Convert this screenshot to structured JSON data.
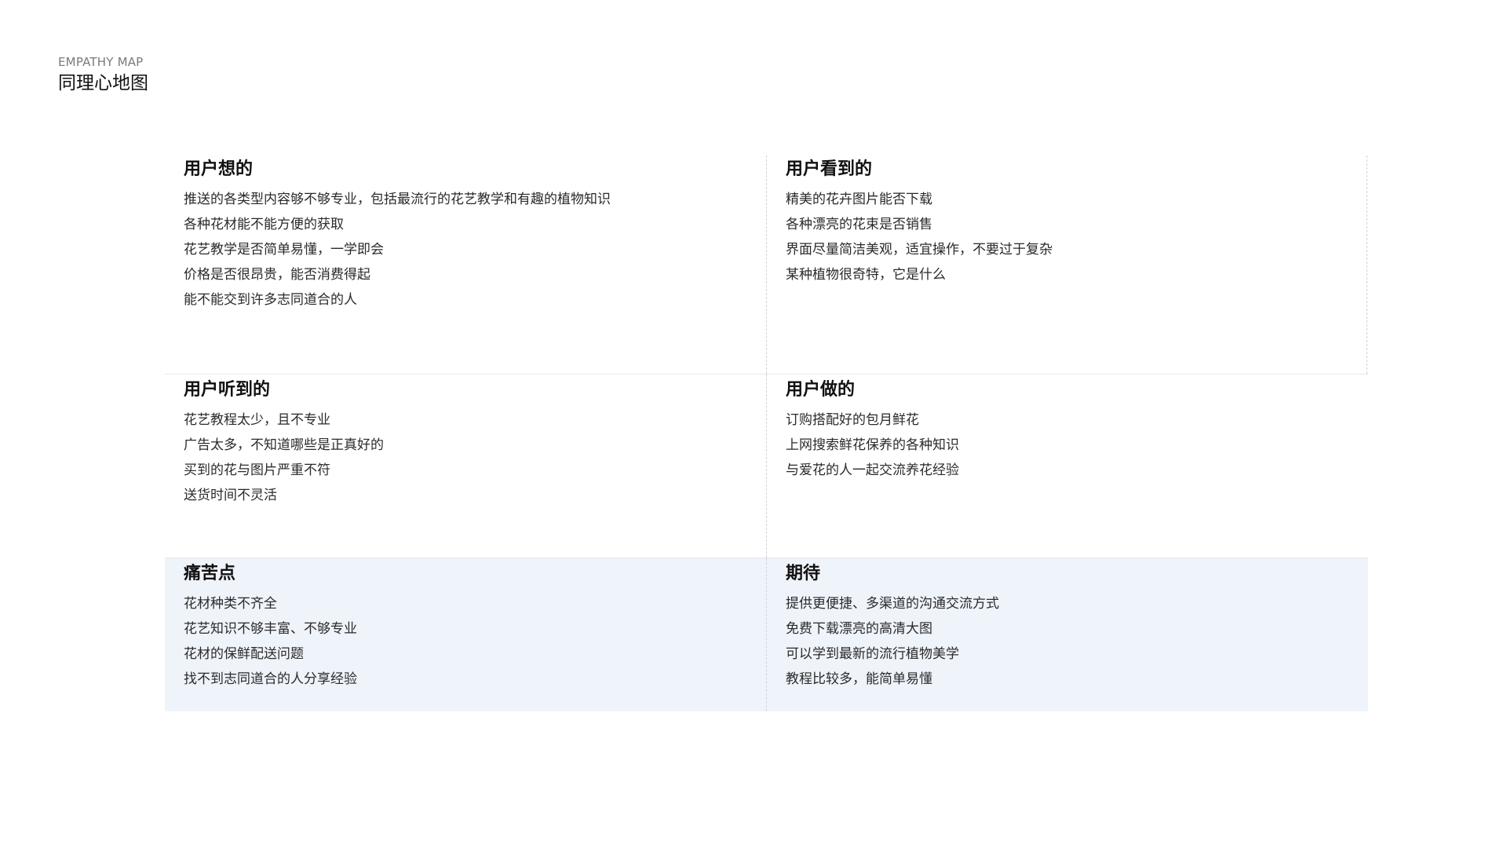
{
  "header": {
    "eyebrow": "EMPATHY MAP",
    "title": "同理心地图"
  },
  "quadrants": {
    "thinks": {
      "title": "用户想的",
      "items": [
        "推送的各类型内容够不够专业，包括最流行的花艺教学和有趣的植物知识",
        "各种花材能不能方便的获取",
        "花艺教学是否简单易懂，一学即会",
        "价格是否很昂贵，能否消费得起",
        "能不能交到许多志同道合的人"
      ]
    },
    "sees": {
      "title": "用户看到的",
      "items": [
        "精美的花卉图片能否下载",
        "各种漂亮的花束是否销售",
        "界面尽量简洁美观，适宜操作，不要过于复杂",
        "某种植物很奇特，它是什么"
      ]
    },
    "hears": {
      "title": "用户听到的",
      "items": [
        "花艺教程太少，且不专业",
        "广告太多，不知道哪些是正真好的",
        "买到的花与图片严重不符",
        "送货时间不灵活"
      ]
    },
    "does": {
      "title": "用户做的",
      "items": [
        "订购搭配好的包月鲜花",
        "上网搜索鲜花保养的各种知识",
        "与爱花的人一起交流养花经验"
      ]
    },
    "pains": {
      "title": "痛苦点",
      "items": [
        "花材种类不齐全",
        "花艺知识不够丰富、不够专业",
        "花材的保鲜配送问题",
        "找不到志同道合的人分享经验"
      ]
    },
    "gains": {
      "title": "期待",
      "items": [
        "提供更便捷、多渠道的沟通交流方式",
        "免费下载漂亮的高清大图",
        "可以学到最新的流行植物美学",
        "教程比较多，能简单易懂"
      ]
    }
  },
  "colors": {
    "bottom_band": "#eff3fa",
    "divider": "#cfd3da"
  }
}
